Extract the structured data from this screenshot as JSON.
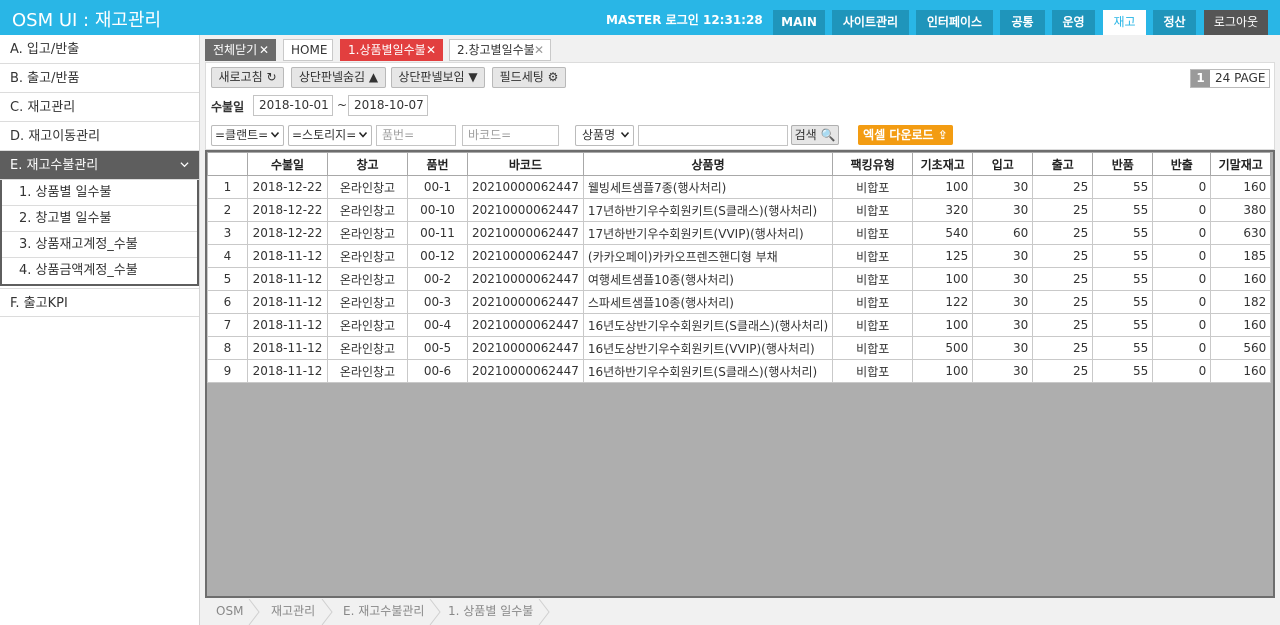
{
  "header": {
    "app_title": "OSM UI : 재고관리",
    "login_info": "MASTER 로그인 12:31:28",
    "nav": [
      "MAIN",
      "사이트관리",
      "인터페이스",
      "공통",
      "운영",
      "재고",
      "정산",
      "로그아웃"
    ],
    "active_nav": "재고"
  },
  "sidebar": {
    "items": [
      "A. 입고/반출",
      "B. 출고/반품",
      "C. 재고관리",
      "D. 재고이동관리",
      "E. 재고수불관리"
    ],
    "open_item": "E. 재고수불관리",
    "sub_items": [
      "1. 상품별 일수불",
      "2. 창고별 일수불",
      "3. 상품재고계정_수불",
      "4. 상품금액계정_수불"
    ],
    "after_items": [
      "F. 출고KPI"
    ]
  },
  "tabs": {
    "close_all": "전체닫기",
    "items": [
      "HOME",
      "1.상품별일수불",
      "2.창고별일수불"
    ],
    "active": "1.상품별일수불"
  },
  "toolbar": {
    "refresh": "새로고침",
    "hide_panel": "상단판넬숨김",
    "show_panel": "상단판넬보임",
    "field_setting": "필드세팅",
    "page_current": "1",
    "page_total": "24 PAGE"
  },
  "filters": {
    "date_label": "수불일",
    "date_from": "2018-10-01",
    "date_sep": "~",
    "date_to": "2018-10-07",
    "client_select": "=클랜트=",
    "story_select": "=스토리지=",
    "item_no_placeholder": "품번=",
    "barcode_placeholder": "바코드=",
    "product_select": "상품명",
    "search_button": "검색",
    "excel_button": "엑셀 다운로드"
  },
  "table": {
    "columns": [
      "",
      "수불일",
      "창고",
      "품번",
      "바코드",
      "상품명",
      "팩킹유형",
      "기초재고",
      "입고",
      "출고",
      "반품",
      "반출",
      "기말재고"
    ],
    "rows": [
      [
        "1",
        "2018-12-22",
        "온라인창고",
        "00-1",
        "20210000062447",
        "웰빙세트샘플7종(행사처리)",
        "비합포",
        "100",
        "30",
        "25",
        "55",
        "0",
        "160"
      ],
      [
        "2",
        "2018-12-22",
        "온라인창고",
        "00-10",
        "20210000062447",
        "17년하반기우수회원키트(S클래스)(행사처리)",
        "비합포",
        "320",
        "30",
        "25",
        "55",
        "0",
        "380"
      ],
      [
        "3",
        "2018-12-22",
        "온라인창고",
        "00-11",
        "20210000062447",
        "17년하반기우수회원키트(VVIP)(행사처리)",
        "비합포",
        "540",
        "60",
        "25",
        "55",
        "0",
        "630"
      ],
      [
        "4",
        "2018-11-12",
        "온라인창고",
        "00-12",
        "20210000062447",
        "(카카오페이)카카오프렌즈핸디형 부채",
        "비합포",
        "125",
        "30",
        "25",
        "55",
        "0",
        "185"
      ],
      [
        "5",
        "2018-11-12",
        "온라인창고",
        "00-2",
        "20210000062447",
        "여행세트샘플10종(행사처리)",
        "비합포",
        "100",
        "30",
        "25",
        "55",
        "0",
        "160"
      ],
      [
        "6",
        "2018-11-12",
        "온라인창고",
        "00-3",
        "20210000062447",
        "스파세트샘플10종(행사처리)",
        "비합포",
        "122",
        "30",
        "25",
        "55",
        "0",
        "182"
      ],
      [
        "7",
        "2018-11-12",
        "온라인창고",
        "00-4",
        "20210000062447",
        "16년도상반기우수회원키트(S클래스)(행사처리)",
        "비합포",
        "100",
        "30",
        "25",
        "55",
        "0",
        "160"
      ],
      [
        "8",
        "2018-11-12",
        "온라인창고",
        "00-5",
        "20210000062447",
        "16년도상반기우수회원키트(VVIP)(행사처리)",
        "비합포",
        "500",
        "30",
        "25",
        "55",
        "0",
        "560"
      ],
      [
        "9",
        "2018-11-12",
        "온라인창고",
        "00-6",
        "20210000062447",
        "16년하반기우수회원키트(S클래스)(행사처리)",
        "비합포",
        "100",
        "30",
        "25",
        "55",
        "0",
        "160"
      ]
    ]
  },
  "breadcrumb": [
    "OSM",
    "재고관리",
    "E. 재고수불관리",
    "1. 상품별 일수불"
  ],
  "colors": {
    "header_bg": "#29b6e6",
    "nav_button": "#1f95bb",
    "active_tab": "#e23f3f",
    "excel_button": "#f39c12",
    "sidebar_open": "#5e5e5e"
  }
}
